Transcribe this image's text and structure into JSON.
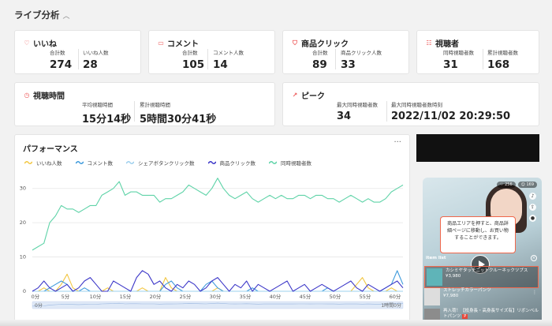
{
  "section_title": "ライブ分析",
  "cards": {
    "likes": {
      "title": "いいね",
      "m1_label": "合計数",
      "m1_value": "274",
      "m2_label": "いいね人数",
      "m2_value": "28"
    },
    "comments": {
      "title": "コメント",
      "m1_label": "合計数",
      "m1_value": "105",
      "m2_label": "コメント人数",
      "m2_value": "14"
    },
    "clicks": {
      "title": "商品クリック",
      "m1_label": "合計数",
      "m1_value": "89",
      "m2_label": "商品クリック人数",
      "m2_value": "33"
    },
    "viewers": {
      "title": "視聴者",
      "m1_label": "同時視聴者数",
      "m1_value": "31",
      "m2_label": "累計視聴者数",
      "m2_value": "168"
    },
    "watch_time": {
      "title": "視聴時間",
      "m1_label": "平均視聴時間",
      "m1_value": "15分14秒",
      "m2_label": "累計視聴時間",
      "m2_value": "5時間30分41秒"
    },
    "peak": {
      "title": "ピーク",
      "m1_label": "最大同時視聴者数",
      "m1_value": "34",
      "m2_label": "最大同時視聴者数時刻",
      "m2_value": "2022/11/02 20:29:50"
    }
  },
  "performance": {
    "title": "パフォーマンス",
    "menu": "···",
    "range_start": "0分",
    "range_end": "1時間0分"
  },
  "chart_data": {
    "type": "line",
    "x": [
      0,
      1,
      2,
      3,
      4,
      5,
      6,
      7,
      8,
      9,
      10,
      11,
      12,
      13,
      14,
      15,
      16,
      17,
      18,
      19,
      20,
      21,
      22,
      23,
      24,
      25,
      26,
      27,
      28,
      29,
      30,
      31,
      32,
      33,
      34,
      35,
      36,
      37,
      38,
      39,
      40,
      41,
      42,
      43,
      44,
      45,
      46,
      47,
      48,
      49,
      50,
      51,
      52,
      53,
      54,
      55,
      56,
      57,
      58,
      59,
      60,
      61,
      62,
      63,
      64
    ],
    "x_tick_labels": [
      "0分",
      "5分",
      "10分",
      "15分",
      "20分",
      "25分",
      "30分",
      "35分",
      "40分",
      "45分",
      "50分",
      "55分",
      "60分"
    ],
    "y_tick_labels": [
      "0",
      "10",
      "20",
      "30"
    ],
    "ylim": [
      0,
      35
    ],
    "grid": true,
    "legend_position": "top",
    "series": [
      {
        "name": "いいね人数",
        "color": "#f2c744",
        "values": [
          0,
          0,
          1,
          0,
          0,
          2,
          5,
          1,
          0,
          0,
          0,
          0,
          0,
          1,
          0,
          0,
          0,
          0,
          0,
          1,
          0,
          0,
          0,
          4,
          1,
          0,
          0,
          0,
          0,
          0,
          0,
          0,
          1,
          0,
          0,
          0,
          0,
          0,
          0,
          0,
          0,
          0,
          0,
          0,
          0,
          0,
          0,
          0,
          0,
          0,
          0,
          0,
          0,
          0,
          0,
          0,
          2,
          4,
          1,
          0,
          0,
          0,
          1,
          0,
          0
        ]
      },
      {
        "name": "コメント数",
        "color": "#3f9bdc",
        "values": [
          0,
          0,
          0,
          1,
          2,
          3,
          2,
          0,
          0,
          1,
          0,
          0,
          0,
          0,
          0,
          0,
          0,
          0,
          0,
          0,
          0,
          0,
          0,
          2,
          3,
          1,
          0,
          0,
          0,
          0,
          2,
          3,
          1,
          0,
          0,
          0,
          0,
          0,
          1,
          0,
          0,
          0,
          0,
          0,
          0,
          0,
          0,
          0,
          0,
          0,
          0,
          1,
          0,
          0,
          0,
          0,
          0,
          0,
          0,
          0,
          0,
          1,
          2,
          6,
          2
        ]
      },
      {
        "name": "シェアボタンクリック数",
        "color": "#9ed0ee",
        "values": [
          0,
          0,
          0,
          0,
          0,
          0,
          0,
          0,
          0,
          0,
          0,
          0,
          0,
          0,
          0,
          0,
          0,
          0,
          0,
          0,
          0,
          0,
          0,
          0,
          0,
          0,
          0,
          0,
          0,
          0,
          0,
          0,
          0,
          0,
          0,
          0,
          0,
          0,
          0,
          0,
          0,
          0,
          0,
          0,
          0,
          0,
          0,
          0,
          0,
          0,
          0,
          0,
          0,
          0,
          0,
          0,
          0,
          0,
          0,
          0,
          0,
          0,
          0,
          0,
          0
        ]
      },
      {
        "name": "商品クリック数",
        "color": "#3c37c8",
        "values": [
          0,
          1,
          3,
          1,
          0,
          1,
          2,
          0,
          1,
          3,
          4,
          2,
          0,
          0,
          3,
          2,
          1,
          0,
          4,
          6,
          5,
          2,
          3,
          1,
          0,
          2,
          1,
          3,
          2,
          0,
          1,
          3,
          4,
          2,
          0,
          2,
          1,
          3,
          0,
          2,
          1,
          0,
          1,
          2,
          3,
          0,
          1,
          2,
          0,
          1,
          2,
          1,
          0,
          1,
          2,
          3,
          1,
          0,
          2,
          1,
          0,
          1,
          2,
          3,
          1
        ]
      },
      {
        "name": "同時視聴者数",
        "color": "#5fd3a8",
        "values": [
          12,
          13,
          14,
          20,
          22,
          25,
          24,
          24,
          23,
          24,
          25,
          25,
          28,
          29,
          30,
          32,
          28,
          29,
          29,
          28,
          28,
          28,
          26,
          27,
          27,
          28,
          29,
          31,
          30,
          29,
          28,
          30,
          33,
          30,
          28,
          27,
          28,
          29,
          27,
          26,
          27,
          28,
          27,
          28,
          27,
          27,
          28,
          28,
          27,
          28,
          28,
          27,
          27,
          26,
          27,
          28,
          27,
          26,
          27,
          26,
          26,
          27,
          29,
          30,
          31
        ]
      }
    ]
  },
  "preview": {
    "likes_badge": "256",
    "viewers_badge": "169",
    "tooltip": "商品エリアを押すと、商品詳細ページに移動し、お買い物することができます。",
    "item_list_label": "item list",
    "item1_name": "カシミヤタッチニットクルーネックツプス",
    "item1_price": "¥3,980",
    "item2_name": "ストレッチカラーパンツ",
    "item2_price": "¥7,980",
    "item3_name": "再入荷！【抵身長・高身長サイズ有】リボンベルトパンツ",
    "item3_tag": "P"
  }
}
